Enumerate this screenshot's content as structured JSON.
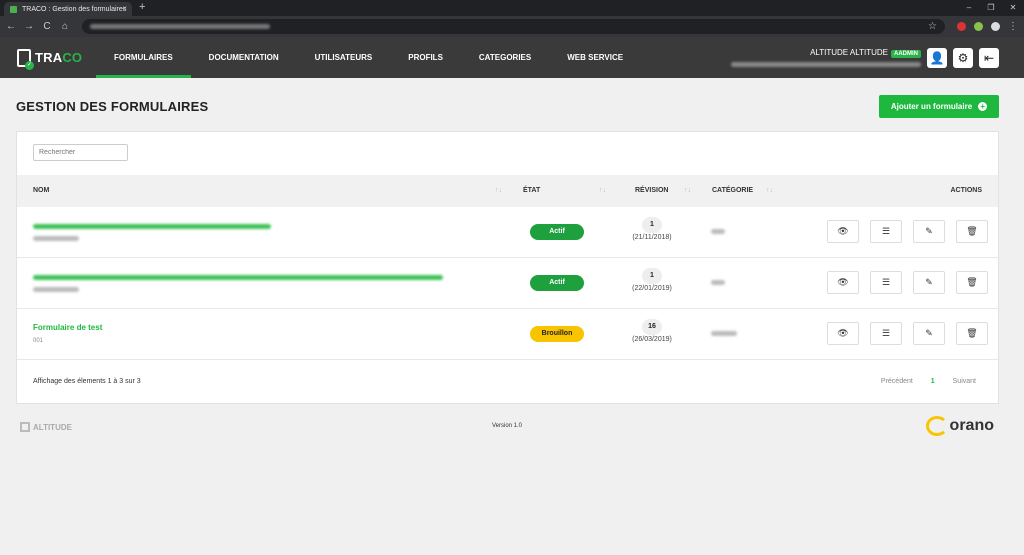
{
  "browser": {
    "tab_title": "TRACO : Gestion des formulaires",
    "close": "×",
    "new_tab": "+",
    "back": "←",
    "forward": "→",
    "reload": "C",
    "home": "⌂",
    "star": "☆",
    "menu": "⋮",
    "minimize": "–",
    "restore": "❐",
    "close_window": "✕"
  },
  "header": {
    "logo_prefix": "TRA",
    "logo_suffix": "CO",
    "nav": [
      {
        "label": "FORMULAIRES"
      },
      {
        "label": "DOCUMENTATION"
      },
      {
        "label": "UTILISATEURS"
      },
      {
        "label": "PROFILS"
      },
      {
        "label": "CATEGORIES"
      },
      {
        "label": "WEB SERVICE"
      }
    ],
    "user_name": "ALTITUDE ALTITUDE",
    "user_badge": "AADMIN"
  },
  "page": {
    "title": "GESTION DES FORMULAIRES",
    "add_button": "Ajouter un formulaire"
  },
  "table": {
    "search_placeholder": "Rechercher",
    "columns": {
      "nom": "NOM",
      "etat": "ÉTAT",
      "revision": "RÉVISION",
      "categorie": "CATÉGORIE",
      "actions": "ACTIONS"
    },
    "sort_glyph": "↑↓",
    "rows": [
      {
        "name": "",
        "code": "",
        "status": "Actif",
        "revision": "1",
        "date": "(21/11/2018)"
      },
      {
        "name": "",
        "code": "",
        "status": "Actif",
        "revision": "1",
        "date": "(22/01/2019)"
      },
      {
        "name": "Formulaire de test",
        "code": "001",
        "status": "Brouillon",
        "revision": "16",
        "date": "(26/03/2019)"
      }
    ],
    "info": "Affichage des élements 1 à 3 sur 3",
    "prev": "Précédent",
    "page": "1",
    "next": "Suivant"
  },
  "footer": {
    "brand_left": "ALTITUDE",
    "version": "Version 1.0",
    "brand_right": "orano"
  },
  "colors": {
    "accent": "#1eb83e",
    "header_bg": "#3a3a3a",
    "draft": "#f8c400"
  }
}
